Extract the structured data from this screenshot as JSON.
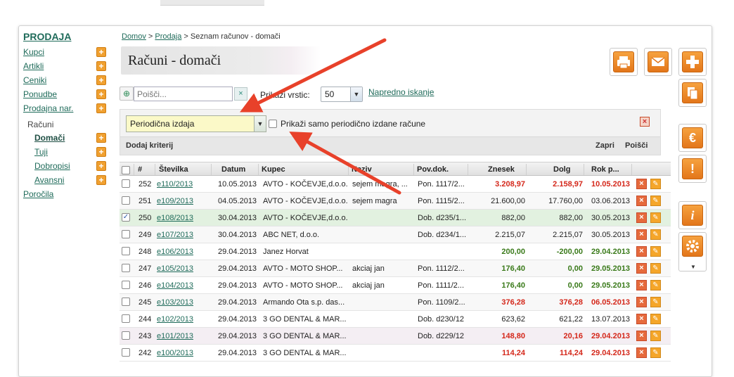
{
  "sidebar": {
    "title": "PRODAJA",
    "items": [
      {
        "label": "Kupci"
      },
      {
        "label": "Artikli"
      },
      {
        "label": "Ceniki"
      },
      {
        "label": "Ponudbe"
      },
      {
        "label": "Prodajna nar."
      }
    ],
    "group_label": "Računi",
    "sub_items": [
      {
        "label": "Domači"
      },
      {
        "label": "Tuji"
      },
      {
        "label": "Dobropisi"
      },
      {
        "label": "Avansni"
      }
    ],
    "reports": "Poročila"
  },
  "breadcrumb": {
    "home": "Domov",
    "sales": "Prodaja",
    "sep": ">",
    "current": "Seznam računov - domači"
  },
  "page_title": "Računi - domači",
  "search": {
    "placeholder": "Poišči...",
    "clear_icon": "×"
  },
  "rows_per_page": {
    "label": "Prikaži vrstic:",
    "value": "50"
  },
  "advanced_search": "Napredno iskanje",
  "filter": {
    "select_value": "Periodična izdaja",
    "checkbox_label": "Prikaži samo periodično izdane račune",
    "add_criteria": "Dodaj kriterij",
    "close": "Zapri",
    "search": "Poišči"
  },
  "table": {
    "headers": {
      "hash": "#",
      "number": "Številka",
      "date": "Datum",
      "customer": "Kupec",
      "title": "Naziv",
      "ref": "Pov.dok.",
      "amount": "Znesek",
      "debt": "Dolg",
      "due": "Rok p..."
    },
    "rows": [
      {
        "id": "252",
        "number": "e110/2013",
        "date": "10.05.2013",
        "customer": "AVTO - KOČEVJE,d.o.o.",
        "title": "sejem magra, ...",
        "ref": "Pon. 1117/2...",
        "amount": "3.208,97",
        "debt": "2.158,97",
        "due": "10.05.2013",
        "color": "red",
        "checked": false
      },
      {
        "id": "251",
        "number": "e109/2013",
        "date": "04.05.2013",
        "customer": "AVTO - KOČEVJE,d.o.o.",
        "title": "sejem magra",
        "ref": "Pon. 1115/2...",
        "amount": "21.600,00",
        "debt": "17.760,00",
        "due": "03.06.2013",
        "color": "black",
        "checked": false
      },
      {
        "id": "250",
        "number": "e108/2013",
        "date": "30.04.2013",
        "customer": "AVTO - KOČEVJE,d.o.o.",
        "title": "",
        "ref": "Dob. d235/1...",
        "amount": "882,00",
        "debt": "882,00",
        "due": "30.05.2013",
        "color": "black",
        "checked": true
      },
      {
        "id": "249",
        "number": "e107/2013",
        "date": "30.04.2013",
        "customer": "ABC NET, d.o.o.",
        "title": "",
        "ref": "Dob. d234/1...",
        "amount": "2.215,07",
        "debt": "2.215,07",
        "due": "30.05.2013",
        "color": "black",
        "checked": false
      },
      {
        "id": "248",
        "number": "e106/2013",
        "date": "29.04.2013",
        "customer": "Janez Horvat",
        "title": "",
        "ref": "",
        "amount": "200,00",
        "debt": "-200,00",
        "due": "29.04.2013",
        "color": "green",
        "checked": false
      },
      {
        "id": "247",
        "number": "e105/2013",
        "date": "29.04.2013",
        "customer": "AVTO - MOTO SHOP...",
        "title": "akciaj jan",
        "ref": "Pon. 1112/2...",
        "amount": "176,40",
        "debt": "0,00",
        "due": "29.05.2013",
        "color": "green",
        "checked": false
      },
      {
        "id": "246",
        "number": "e104/2013",
        "date": "29.04.2013",
        "customer": "AVTO - MOTO SHOP...",
        "title": "akciaj jan",
        "ref": "Pon. 1111/2...",
        "amount": "176,40",
        "debt": "0,00",
        "due": "29.05.2013",
        "color": "green",
        "checked": false
      },
      {
        "id": "245",
        "number": "e103/2013",
        "date": "29.04.2013",
        "customer": "Armando Ota s.p. das...",
        "title": "",
        "ref": "Pon. 1109/2...",
        "amount": "376,28",
        "debt": "376,28",
        "due": "06.05.2013",
        "color": "red",
        "checked": false
      },
      {
        "id": "244",
        "number": "e102/2013",
        "date": "29.04.2013",
        "customer": "3 GO DENTAL & MAR...",
        "title": "",
        "ref": "Dob. d230/12",
        "amount": "623,62",
        "debt": "621,22",
        "due": "13.07.2013",
        "color": "black",
        "checked": false
      },
      {
        "id": "243",
        "number": "e101/2013",
        "date": "29.04.2013",
        "customer": "3 GO DENTAL & MAR...",
        "title": "",
        "ref": "Dob. d229/12",
        "amount": "148,80",
        "debt": "20,16",
        "due": "29.04.2013",
        "color": "red",
        "checked": false
      },
      {
        "id": "242",
        "number": "e100/2013",
        "date": "29.04.2013",
        "customer": "3 GO DENTAL & MAR...",
        "title": "",
        "ref": "",
        "amount": "114,24",
        "debt": "114,24",
        "due": "29.04.2013",
        "color": "red",
        "checked": false
      }
    ]
  },
  "icons": {
    "print": "printer-icon",
    "email": "envelope-icon",
    "add": "plus-icon",
    "copy": "copy-icon",
    "euro": "euro-icon",
    "warning": "exclamation-icon",
    "info": "info-icon",
    "settings": "gear-icon"
  },
  "colors": {
    "accent_orange": "#f08a24",
    "link_green": "#1f6b5a",
    "red": "#d4271a",
    "green": "#3a7a1a",
    "arrow": "#e8412a"
  }
}
